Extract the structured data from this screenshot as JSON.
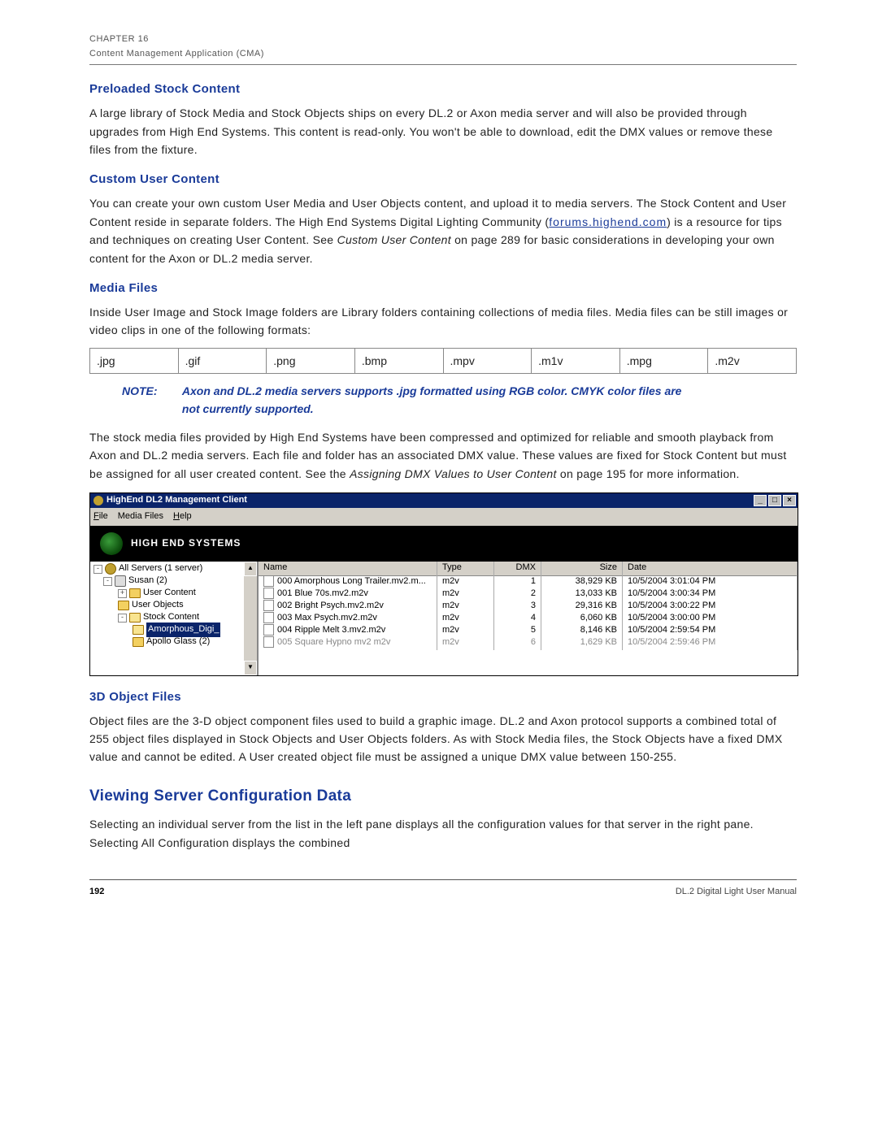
{
  "header": {
    "chapter": "CHAPTER 16",
    "section": "Content Management Application (CMA)"
  },
  "sec1": {
    "title": "Preloaded Stock Content",
    "para": "A large library of Stock Media and Stock Objects ships on every DL.2 or Axon media server and will also be provided through upgrades from High End Systems. This content is read-only. You won't be able to download, edit the DMX values or remove these files from the fixture."
  },
  "sec2": {
    "title": "Custom User Content",
    "para1": "You can create your own custom User Media and User Objects content, and upload it to media servers. The Stock Content and User Content reside in separate folders. The High End Systems Digital Lighting Community (",
    "link_text": "forums.highend.com",
    "para2": ") is a resource for tips and techniques on creating User Content. See ",
    "ref1": "Custom User Content",
    "para3": " on page 289 for basic considerations in developing your own content for the Axon or DL.2 media server."
  },
  "sec3": {
    "title": "Media Files",
    "para1": "Inside User Image and Stock Image folders are Library folders containing collections of media files. Media files can be still images or video clips in one of the following formats:",
    "formats": [
      ".jpg",
      ".gif",
      ".png",
      ".bmp",
      ".mpv",
      ".m1v",
      ".mpg",
      ".m2v"
    ],
    "note_label": "NOTE:",
    "note_body": "Axon and DL.2 media servers supports .jpg formatted using RGB color. CMYK color files are not currently supported.",
    "para2a": "The stock media files provided by High End Systems have been compressed and optimized for reliable and smooth playback from Axon and DL.2 media servers. Each file and folder has an associated DMX value. These values are fixed for Stock Content but must be assigned for all user created content. See the ",
    "ref2": "Assigning DMX Values to User Content",
    "para2b": " on page 195 for more information."
  },
  "win": {
    "title": "HighEnd DL2 Management Client",
    "btn_min": "_",
    "btn_max": "□",
    "btn_close": "×",
    "menu": {
      "file": "File",
      "media": "Media Files",
      "help": "Help"
    },
    "brand": "HIGH END SYSTEMS",
    "tree": {
      "root": "All Servers (1 server)",
      "server": "Susan (2)",
      "user_content": "User Content",
      "user_objects": "User Objects",
      "stock_content": "Stock Content",
      "amorphous": "Amorphous_Digi_",
      "apollo": "Apollo Glass (2)"
    },
    "columns": {
      "name": "Name",
      "type": "Type",
      "dmx": "DMX",
      "size": "Size",
      "date": "Date"
    },
    "rows": [
      {
        "name": "000 Amorphous Long Trailer.mv2.m...",
        "type": "m2v",
        "dmx": "1",
        "size": "38,929 KB",
        "date": "10/5/2004 3:01:04 PM"
      },
      {
        "name": "001 Blue 70s.mv2.m2v",
        "type": "m2v",
        "dmx": "2",
        "size": "13,033 KB",
        "date": "10/5/2004 3:00:34 PM"
      },
      {
        "name": "002 Bright Psych.mv2.m2v",
        "type": "m2v",
        "dmx": "3",
        "size": "29,316 KB",
        "date": "10/5/2004 3:00:22 PM"
      },
      {
        "name": "003 Max Psych.mv2.m2v",
        "type": "m2v",
        "dmx": "4",
        "size": "6,060 KB",
        "date": "10/5/2004 3:00:00 PM"
      },
      {
        "name": "004 Ripple Melt 3.mv2.m2v",
        "type": "m2v",
        "dmx": "5",
        "size": "8,146 KB",
        "date": "10/5/2004 2:59:54 PM"
      },
      {
        "name": "005 Square Hypno mv2 m2v",
        "type": "m2v",
        "dmx": "6",
        "size": "1,629 KB",
        "date": "10/5/2004 2:59:46 PM"
      }
    ]
  },
  "sec4": {
    "title": "3D Object Files",
    "para": "Object files are the 3-D object component files used to build a graphic image. DL.2 and Axon protocol supports a combined total of 255 object files displayed in Stock Objects and User Objects folders. As with Stock Media files, the Stock Objects have a fixed DMX value and cannot be edited. A User created object file must be assigned a unique DMX value between 150-255."
  },
  "sec5": {
    "title": "Viewing Server Configuration Data",
    "para": "Selecting an individual server from the list in the left pane displays all the configuration values for that server in the right pane. Selecting All Configuration displays the combined"
  },
  "footer": {
    "page": "192",
    "manual": "DL.2 Digital Light User Manual"
  }
}
